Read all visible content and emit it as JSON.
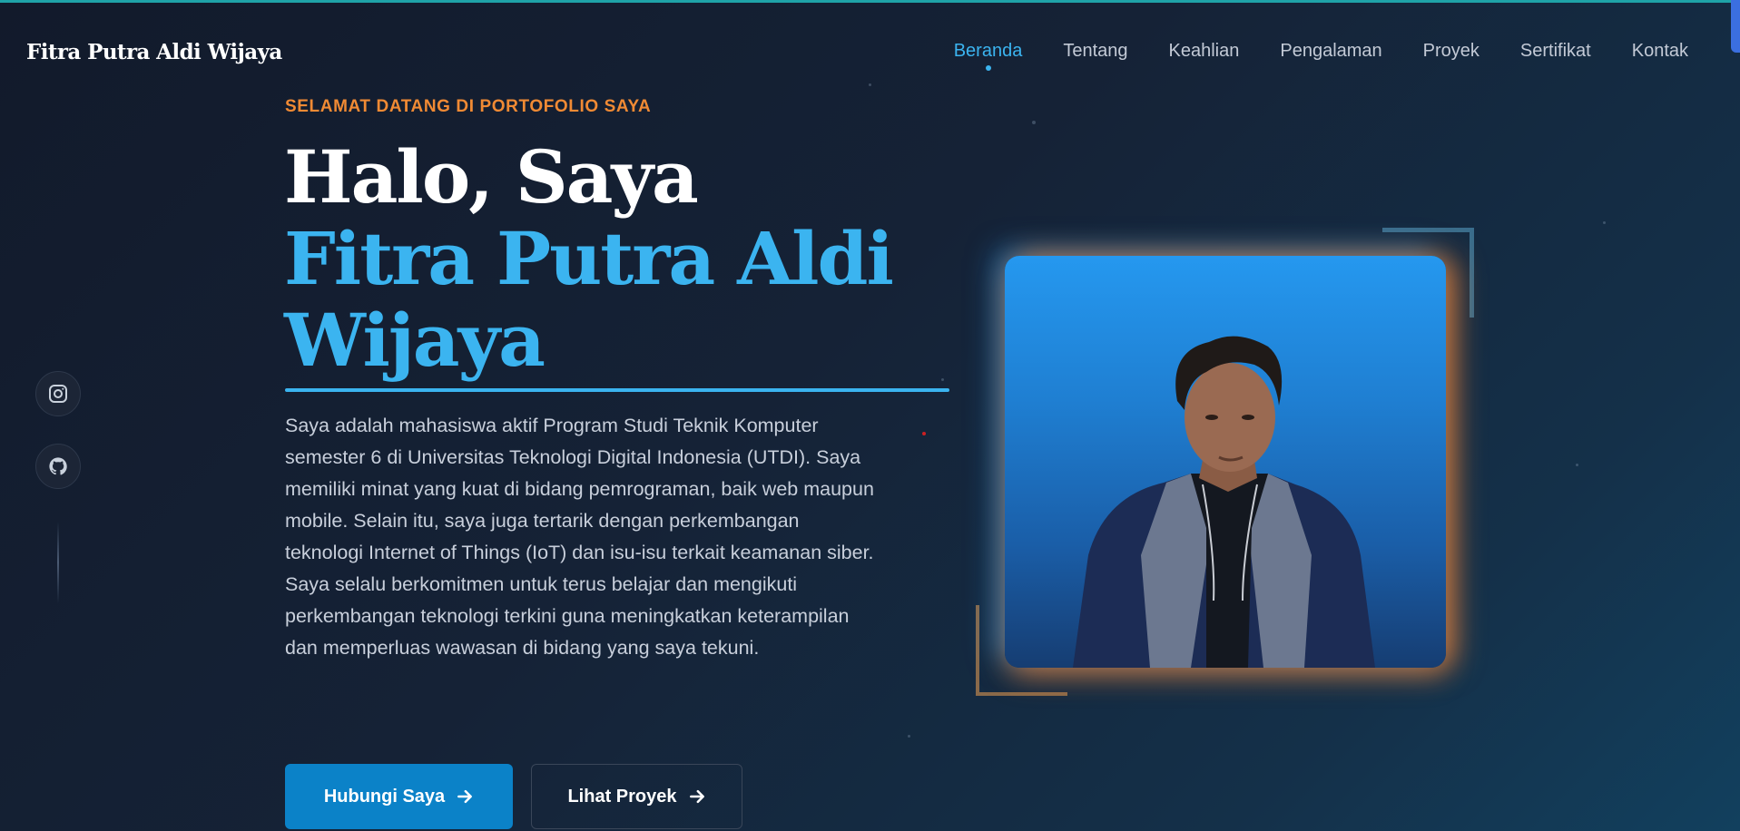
{
  "brand": {
    "name": "Fitra Putra Aldi Wijaya"
  },
  "nav": {
    "items": [
      {
        "label": "Beranda",
        "active": true
      },
      {
        "label": "Tentang"
      },
      {
        "label": "Keahlian"
      },
      {
        "label": "Pengalaman"
      },
      {
        "label": "Proyek"
      },
      {
        "label": "Sertifikat"
      },
      {
        "label": "Kontak"
      }
    ]
  },
  "social": {
    "icons": [
      "instagram-icon",
      "github-icon"
    ]
  },
  "hero": {
    "eyebrow": "SELAMAT DATANG DI PORTOFOLIO SAYA",
    "greeting": "Halo, Saya",
    "name": "Fitra Putra Aldi Wijaya",
    "bio": "Saya adalah mahasiswa aktif Program Studi Teknik Komputer semester 6 di Universitas Teknologi Digital Indonesia (UTDI). Saya memiliki minat yang kuat di bidang pemrograman, baik web maupun mobile. Selain itu, saya juga tertarik dengan perkembangan teknologi Internet of Things (IoT) dan isu-isu terkait keamanan siber. Saya selalu berkomitmen untuk terus belajar dan mengikuti perkembangan teknologi terkini guna meningkatkan keterampilan dan memperluas wawasan di bidang yang saya tekuni.",
    "primary_button": "Hubungi Saya",
    "secondary_button": "Lihat Proyek"
  },
  "colors": {
    "accent_blue": "#3bb4f0",
    "accent_orange": "#f08a34",
    "button_blue": "#0b82c8",
    "background": "#152236"
  }
}
